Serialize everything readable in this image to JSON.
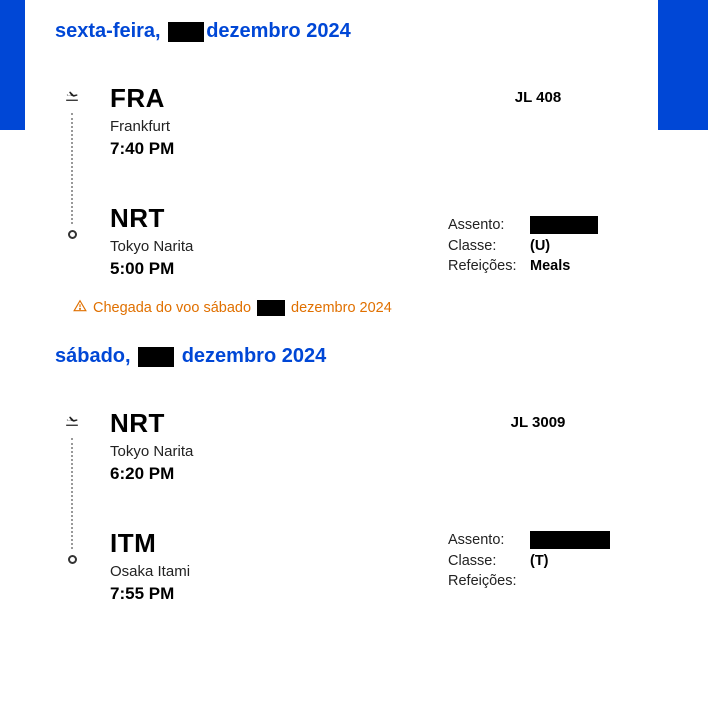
{
  "segments": [
    {
      "date_prefix": "sexta-feira,",
      "date_suffix": "dezembro 2024",
      "flight_number": "JL 408",
      "depart": {
        "code": "FRA",
        "city": "Frankfurt",
        "time": "7:40 PM"
      },
      "arrive": {
        "code": "NRT",
        "city": "Tokyo Narita",
        "time": "5:00 PM"
      },
      "info": {
        "seat_label": "Assento:",
        "class_label": "Classe:",
        "class_value": "(U)",
        "meals_label": "Refeições:",
        "meals_value": "Meals"
      },
      "arrival_note_prefix": "Chegada do voo sábado",
      "arrival_note_suffix": "dezembro 2024"
    },
    {
      "date_prefix": "sábado,",
      "date_suffix": "dezembro 2024",
      "flight_number": "JL 3009",
      "depart": {
        "code": "NRT",
        "city": "Tokyo Narita",
        "time": "6:20 PM"
      },
      "arrive": {
        "code": "ITM",
        "city": "Osaka Itami",
        "time": "7:55 PM"
      },
      "info": {
        "seat_label": "Assento:",
        "class_label": "Classe:",
        "class_value": "(T)",
        "meals_label": "Refeições:",
        "meals_value": ""
      }
    }
  ]
}
